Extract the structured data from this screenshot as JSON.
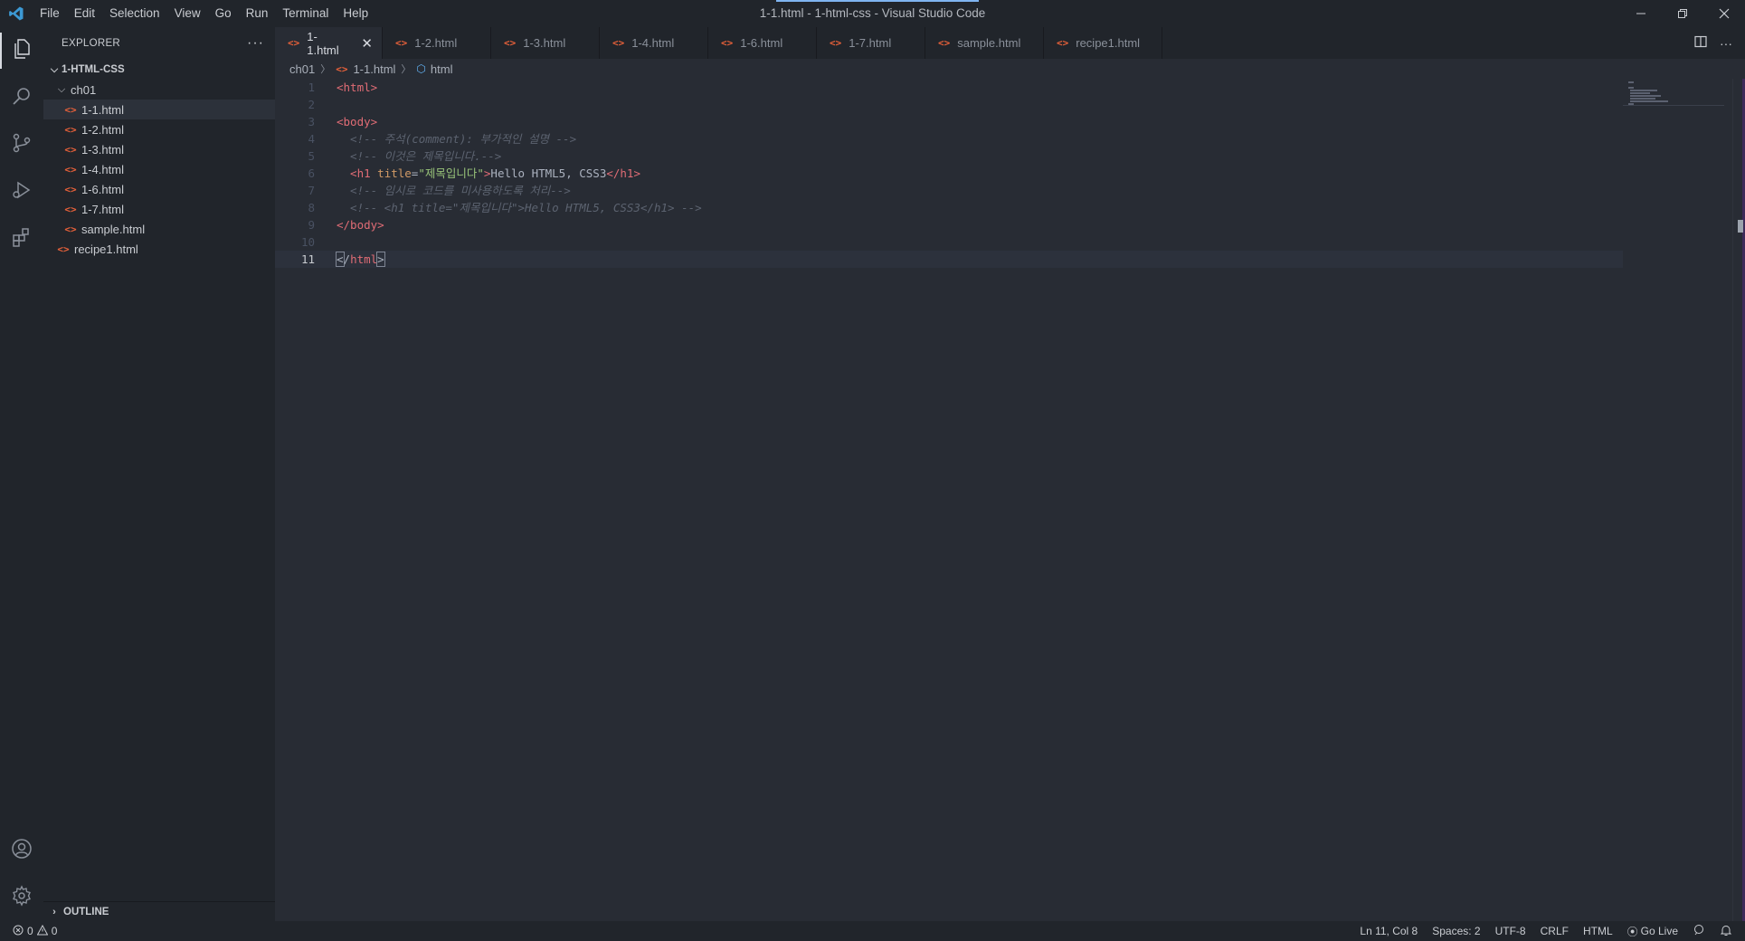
{
  "window": {
    "title": "1-1.html - 1-html-css - Visual Studio Code",
    "menu": [
      "File",
      "Edit",
      "Selection",
      "View",
      "Go",
      "Run",
      "Terminal",
      "Help"
    ]
  },
  "sidebar": {
    "title": "EXPLORER",
    "more": "···",
    "root": "1-HTML-CSS",
    "folder": "ch01",
    "files": [
      "1-1.html",
      "1-2.html",
      "1-3.html",
      "1-4.html",
      "1-6.html",
      "1-7.html",
      "sample.html"
    ],
    "root_files": [
      "recipe1.html"
    ],
    "outline": "OUTLINE"
  },
  "tabs": [
    "1-1.html",
    "1-2.html",
    "1-3.html",
    "1-4.html",
    "1-6.html",
    "1-7.html",
    "sample.html",
    "recipe1.html"
  ],
  "breadcrumb": {
    "folder": "ch01",
    "file": "1-1.html",
    "symbol": "html"
  },
  "code": {
    "line_numbers": [
      "1",
      "2",
      "3",
      "4",
      "5",
      "6",
      "7",
      "8",
      "9",
      "10",
      "11"
    ],
    "l1": "<html>",
    "l3": "<body>",
    "l4": "  <!-- 주석(comment): 부가적인 설명 -->",
    "l5": "  <!-- 이것은 제목입니다.-->",
    "l6_open": "  <h1",
    "l6_attr": " title",
    "l6_eq": "=",
    "l6_str": "\"제목입니다\"",
    "l6_close": ">",
    "l6_text": "Hello HTML5, CSS3",
    "l6_endtag": "</h1>",
    "l7": "  <!-- 임시로 코드를 미사용하도록 처리-->",
    "l8": "  <!-- <h1 title=\"제목입니다\">Hello HTML5, CSS3</h1> -->",
    "l9": "</body>",
    "l11_lt": "<",
    "l11_slash": "/",
    "l11_tag": "html",
    "l11_gt": ">"
  },
  "status": {
    "errors": "0",
    "warnings": "0",
    "position": "Ln 11, Col 8",
    "spaces": "Spaces: 2",
    "encoding": "UTF-8",
    "eol": "CRLF",
    "language": "HTML",
    "golive": "Go Live"
  },
  "colors": {
    "accent": "#7fb4f0",
    "html_icon": "#e8613a",
    "tag": "#e06c75",
    "string": "#98c379",
    "attr": "#d19a66"
  }
}
